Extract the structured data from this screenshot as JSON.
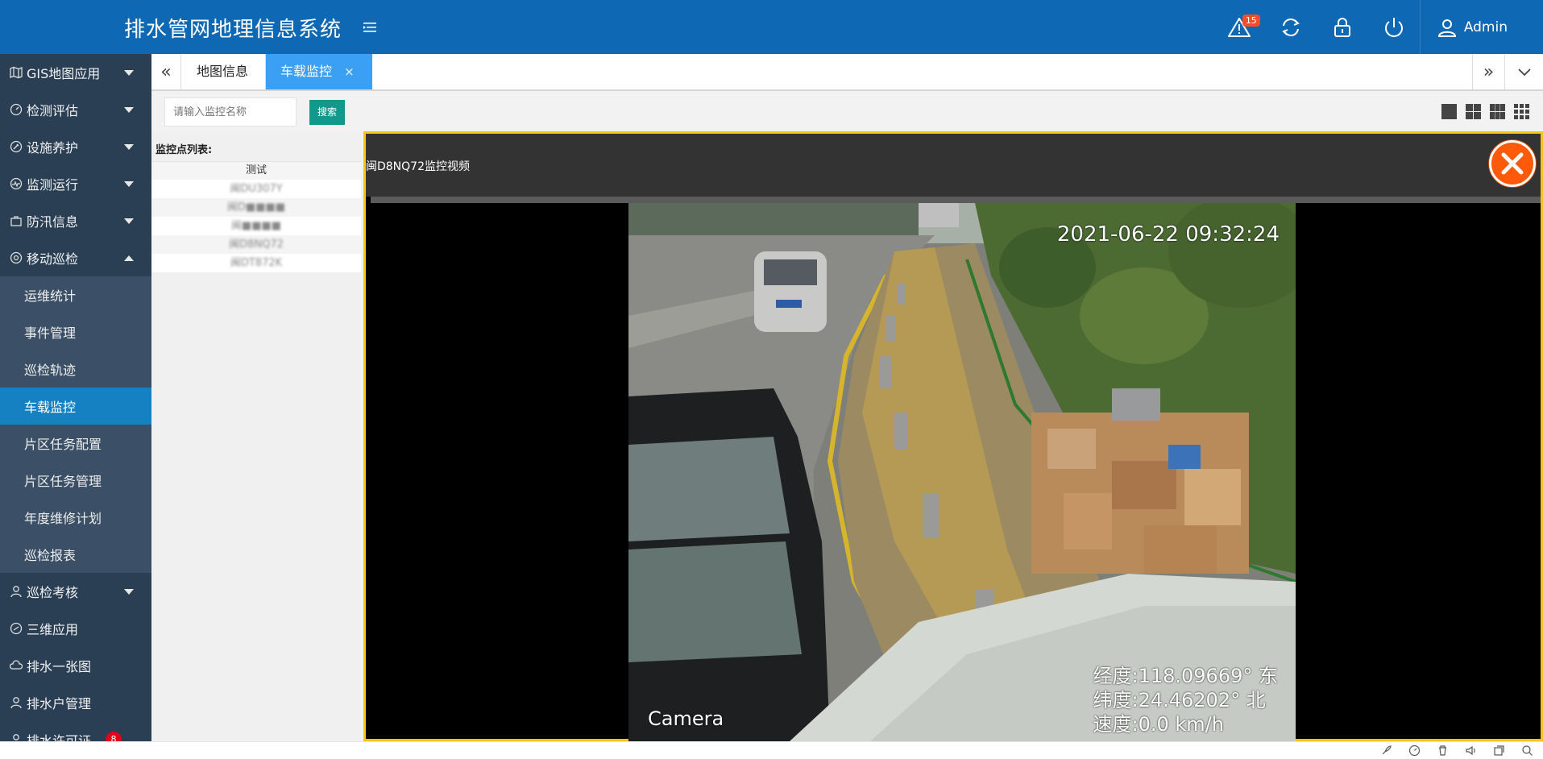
{
  "header": {
    "app_title": "排水管网地理信息系统",
    "alert_count": "15",
    "user_name": "Admin",
    "brand_color": "#0e68b3"
  },
  "sidebar": {
    "items": [
      {
        "label": "GIS地图应用",
        "icon": "map-icon",
        "expandable": true
      },
      {
        "label": "检测评估",
        "icon": "gauge-icon",
        "expandable": true
      },
      {
        "label": "设施养护",
        "icon": "wrench-icon",
        "expandable": true
      },
      {
        "label": "监测运行",
        "icon": "pulse-icon",
        "expandable": true
      },
      {
        "label": "防汛信息",
        "icon": "briefcase-icon",
        "expandable": true
      },
      {
        "label": "移动巡检",
        "icon": "gauge-icon",
        "expanded": true
      }
    ],
    "submenu": [
      {
        "label": "运维统计"
      },
      {
        "label": "事件管理"
      },
      {
        "label": "巡检轨迹"
      },
      {
        "label": "车载监控",
        "active": true
      },
      {
        "label": "片区任务配置"
      },
      {
        "label": "片区任务管理"
      },
      {
        "label": "年度维修计划"
      },
      {
        "label": "巡检报表"
      }
    ],
    "items_after": [
      {
        "label": "巡检考核",
        "icon": "user-icon",
        "expandable": true
      },
      {
        "label": "三维应用",
        "icon": "gauge-icon"
      },
      {
        "label": "排水一张图",
        "icon": "cloud-icon"
      },
      {
        "label": "排水户管理",
        "icon": "user-icon"
      },
      {
        "label": "排水许可证",
        "icon": "user-icon",
        "badge": "8"
      }
    ]
  },
  "tabs": [
    {
      "label": "地图信息"
    },
    {
      "label": "车载监控",
      "active": true,
      "close": "×"
    }
  ],
  "search": {
    "placeholder": "请输入监控名称",
    "button_label": "搜索"
  },
  "monitor_list": {
    "title": "监控点列表:",
    "group": "测试",
    "rows": [
      "闽DU307Y",
      "闽D■■■■",
      "闽■■■■",
      "闽D8NQ72",
      "闽DT872K"
    ]
  },
  "video": {
    "title": "闽D8NQ72监控视频",
    "timestamp": "2021-06-22 09:32:24",
    "camera_label": "Camera",
    "longitude": "经度:118.09669° 东",
    "latitude": "纬度:24.46202° 北",
    "speed": "速度:0.0 km/h",
    "frame_border_color": "#f6c31c"
  }
}
